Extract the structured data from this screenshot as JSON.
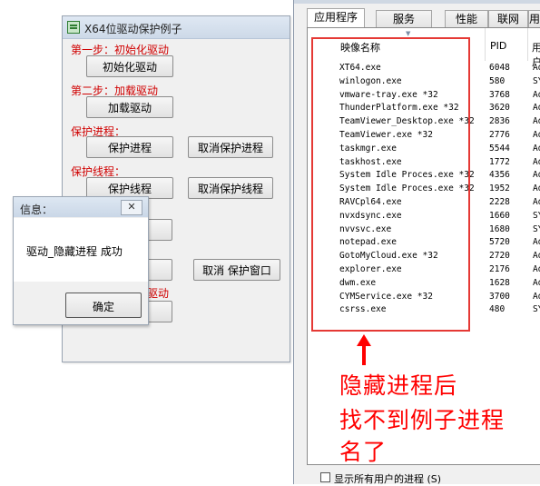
{
  "app_window": {
    "title": "X64位驱动保护例子",
    "step1_label": "第一步：初始化驱动",
    "init_button": "初始化驱动",
    "step2_label": "第二步：加载驱动",
    "load_button": "加载驱动",
    "protect_process_label": "保护进程：",
    "protect_process_button": "保护进程",
    "cancel_protect_process_button": "取消保护进程",
    "protect_thread_label": "保护线程：",
    "protect_thread_button": "保护线程",
    "cancel_protect_thread_button": "取消保护线程",
    "cancel_protect_window_button": "取消 保护窗口",
    "partial_red_text": "驱动"
  },
  "message_box": {
    "title": "信息：",
    "close_glyph": "✕",
    "message": "驱动_隐藏进程 成功",
    "ok_button": "确定"
  },
  "task_manager": {
    "tabs": [
      "应用程序",
      "服务",
      "性能",
      "联网",
      "用"
    ],
    "columns": {
      "name": "映像名称",
      "pid": "PID",
      "user": "用户"
    },
    "processes": [
      {
        "name": "XT64.exe",
        "pid": "6048",
        "user": "Admi"
      },
      {
        "name": "winlogon.exe",
        "pid": "580",
        "user": "SYST"
      },
      {
        "name": "vmware-tray.exe *32",
        "pid": "3768",
        "user": "Admi"
      },
      {
        "name": "ThunderPlatform.exe *32",
        "pid": "3620",
        "user": "Admi"
      },
      {
        "name": "TeamViewer_Desktop.exe *32",
        "pid": "2836",
        "user": "Admi"
      },
      {
        "name": "TeamViewer.exe *32",
        "pid": "2776",
        "user": "Admi"
      },
      {
        "name": "taskmgr.exe",
        "pid": "5544",
        "user": "Admi"
      },
      {
        "name": "taskhost.exe",
        "pid": "1772",
        "user": "Admi"
      },
      {
        "name": "System Idle Proces.exe *32",
        "pid": "4356",
        "user": "Admi"
      },
      {
        "name": "System Idle Proces.exe *32",
        "pid": "1952",
        "user": "Admi"
      },
      {
        "name": "RAVCpl64.exe",
        "pid": "2228",
        "user": "Admi"
      },
      {
        "name": "nvxdsync.exe",
        "pid": "1660",
        "user": "SYST"
      },
      {
        "name": "nvvsvc.exe",
        "pid": "1680",
        "user": "SYST"
      },
      {
        "name": "notepad.exe",
        "pid": "5720",
        "user": "Admi"
      },
      {
        "name": "GotoMyCloud.exe *32",
        "pid": "2720",
        "user": "Admi"
      },
      {
        "name": "explorer.exe",
        "pid": "2176",
        "user": "Admi"
      },
      {
        "name": "dwm.exe",
        "pid": "1628",
        "user": "Admi"
      },
      {
        "name": "CYMService.exe *32",
        "pid": "3700",
        "user": "Admi"
      },
      {
        "name": "csrss.exe",
        "pid": "480",
        "user": "SYST"
      }
    ],
    "show_all_users_label": "显示所有用户的进程 (S)"
  },
  "annotation": {
    "line1": "隐藏进程后",
    "line2": "找不到例子进程",
    "line3": "名了",
    "color": "#ff0000"
  }
}
